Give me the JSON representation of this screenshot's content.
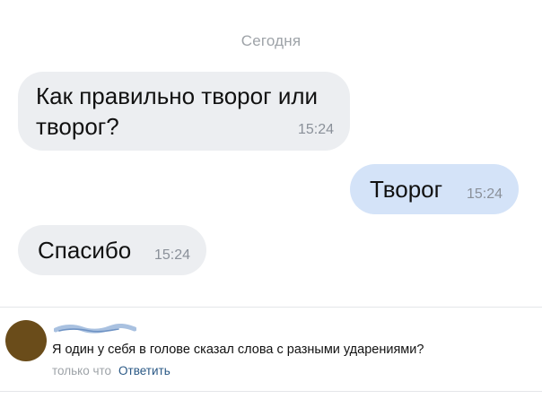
{
  "chat": {
    "date_separator": "Сегодня",
    "messages": [
      {
        "direction": "incoming",
        "text": "Как правильно творог или творог?",
        "time": "15:24"
      },
      {
        "direction": "outgoing",
        "text": "Творог",
        "time": "15:24"
      },
      {
        "direction": "incoming",
        "text": "Спасибо",
        "time": "15:24"
      }
    ]
  },
  "comment": {
    "text": "Я один у себя в голове сказал слова с разными ударениями?",
    "time": "только что",
    "reply_label": "Ответить"
  },
  "colors": {
    "incoming_bubble": "#eceef1",
    "outgoing_bubble": "#d4e3f8",
    "link": "#2a5885",
    "muted": "#9ea3a8",
    "avatar": "#6a4c1a"
  }
}
